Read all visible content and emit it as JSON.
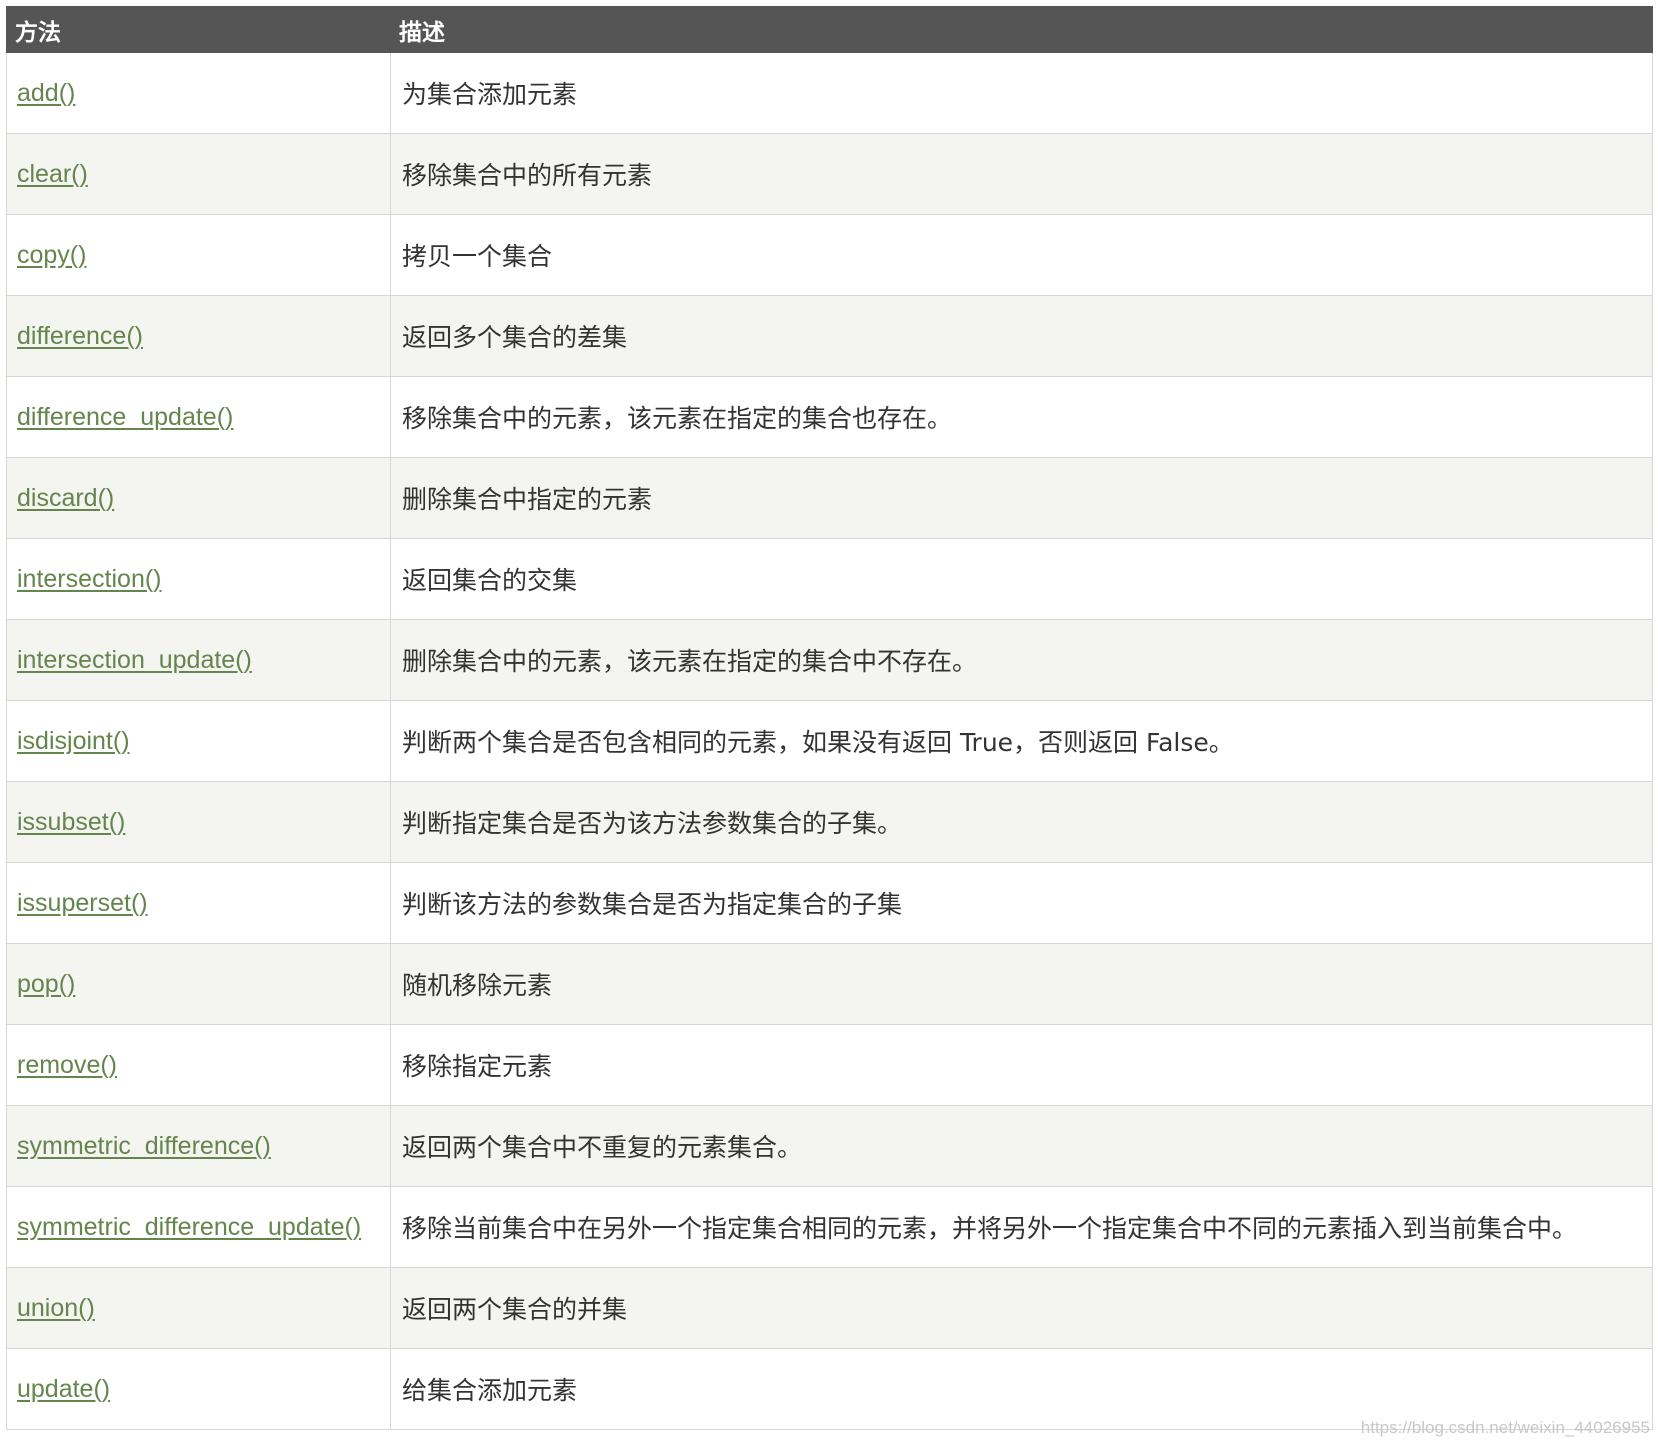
{
  "table": {
    "headers": [
      "方法",
      "描述"
    ],
    "rows": [
      {
        "method": "add()",
        "desc": "为集合添加元素"
      },
      {
        "method": "clear()",
        "desc": "移除集合中的所有元素"
      },
      {
        "method": "copy()",
        "desc": "拷贝一个集合"
      },
      {
        "method": "difference()",
        "desc": "返回多个集合的差集"
      },
      {
        "method": "difference_update()",
        "desc": "移除集合中的元素，该元素在指定的集合也存在。"
      },
      {
        "method": "discard()",
        "desc": "删除集合中指定的元素"
      },
      {
        "method": "intersection()",
        "desc": "返回集合的交集"
      },
      {
        "method": "intersection_update()",
        "desc": "删除集合中的元素，该元素在指定的集合中不存在。"
      },
      {
        "method": "isdisjoint()",
        "desc": "判断两个集合是否包含相同的元素，如果没有返回 True，否则返回 False。"
      },
      {
        "method": "issubset()",
        "desc": "判断指定集合是否为该方法参数集合的子集。"
      },
      {
        "method": "issuperset()",
        "desc": "判断该方法的参数集合是否为指定集合的子集"
      },
      {
        "method": "pop()",
        "desc": "随机移除元素"
      },
      {
        "method": "remove()",
        "desc": "移除指定元素"
      },
      {
        "method": "symmetric_difference()",
        "desc": "返回两个集合中不重复的元素集合。"
      },
      {
        "method": "symmetric_difference_update()",
        "desc": "移除当前集合中在另外一个指定集合相同的元素，并将另外一个指定集合中不同的元素插入到当前集合中。"
      },
      {
        "method": "union()",
        "desc": "返回两个集合的并集"
      },
      {
        "method": "update()",
        "desc": "给集合添加元素"
      }
    ]
  },
  "watermark": "https://blog.csdn.net/weixin_44026955",
  "colors": {
    "header_bg": "#555555",
    "header_text": "#ffffff",
    "link": "#64854c",
    "row_alt": "#f4f4f1",
    "border": "#d6d6d6"
  }
}
